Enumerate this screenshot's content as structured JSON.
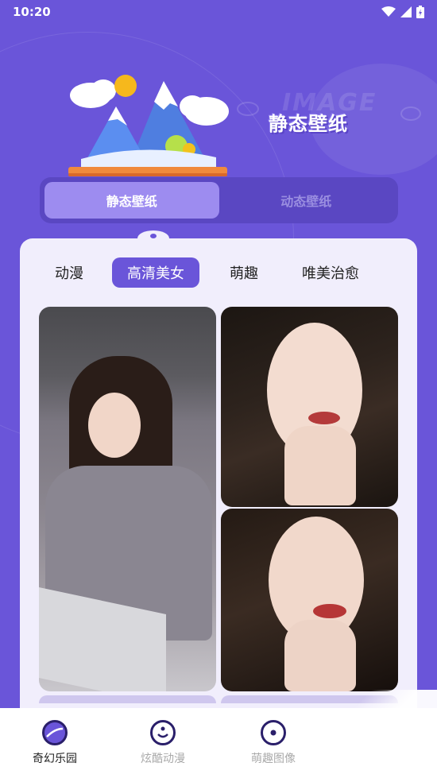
{
  "status_bar": {
    "time": "10:20",
    "icons": [
      "wifi-icon",
      "signal-icon",
      "battery-icon"
    ]
  },
  "hero": {
    "title": "静态壁纸",
    "watermark": "IMAGE",
    "illustration": "mountain-illustration"
  },
  "segment": {
    "tabs": [
      {
        "label": "静态壁纸",
        "active": true
      },
      {
        "label": "动态壁纸",
        "active": false
      }
    ]
  },
  "categories": {
    "tabs": [
      {
        "label": "动漫",
        "active": false
      },
      {
        "label": "高清美女",
        "active": true
      },
      {
        "label": "萌趣",
        "active": false
      },
      {
        "label": "唯美治愈",
        "active": false
      }
    ]
  },
  "bottom_nav": {
    "items": [
      {
        "label": "奇幻乐园",
        "icon": "planet-icon",
        "active": true
      },
      {
        "label": "炫酷动漫",
        "icon": "smile-icon",
        "active": false
      },
      {
        "label": "萌趣图像",
        "icon": "dot-circle-icon",
        "active": false
      }
    ]
  },
  "colors": {
    "primary": "#6a55d9",
    "card": "#f1eefc",
    "segment_active": "#9d8cf0"
  }
}
